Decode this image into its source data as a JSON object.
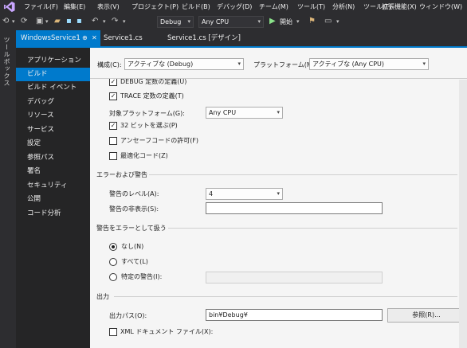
{
  "menubar": {
    "items": [
      "ファイル(F)",
      "編集(E)",
      "表示(V)",
      "プロジェクト(P)",
      "ビルド(B)",
      "デバッグ(D)",
      "チーム(M)",
      "ツール(T)",
      "分析(N)",
      "ツール(T)",
      "拡張機能(X)",
      "ウィンドウ(W)"
    ]
  },
  "toolbar": {
    "config_value": "Debug",
    "platform_value": "Any CPU",
    "start_label": "開始"
  },
  "toolbox": {
    "label": "ツールボックス"
  },
  "tabs": {
    "active": {
      "label": "WindowsService1",
      "pin": "⊕",
      "close": "✕"
    },
    "items": [
      "Service1.cs",
      "Service1.cs [デザイン]"
    ]
  },
  "nav": {
    "items": [
      "アプリケーション",
      "ビルド",
      "ビルド イベント",
      "デバッグ",
      "リソース",
      "サービス",
      "設定",
      "参照パス",
      "署名",
      "セキュリティ",
      "公開",
      "コード分析"
    ],
    "active_index": 1
  },
  "top_settings": {
    "config_label": "構成(C):",
    "config_value": "アクティブな (Debug)",
    "platform_label": "プラットフォーム(M):",
    "platform_value": "アクティブな (Any CPU)"
  },
  "general": {
    "debug_const_label": "DEBUG 定数の定義(U)",
    "trace_const_label": "TRACE 定数の定義(T)",
    "target_platform_label": "対象プラットフォーム(G):",
    "target_platform_value": "Any CPU",
    "prefer32_label": "32 ビットを選ぶ(P)",
    "unsafe_label": "アンセーフコードの許可(F)",
    "optimize_label": "最適化コード(Z)",
    "checks": {
      "debug": true,
      "trace": true,
      "prefer32": true,
      "unsafe": false,
      "optimize": false
    }
  },
  "errors": {
    "section_title": "エラーおよび警告",
    "warning_level_label": "警告のレベル(A):",
    "warning_level_value": "4",
    "suppress_label": "警告の非表示(S):",
    "suppress_value": ""
  },
  "treat_warnings": {
    "section_title": "警告をエラーとして扱う",
    "none_label": "なし(N)",
    "all_label": "すべて(L)",
    "specific_label": "特定の警告(I):",
    "specific_value": "",
    "selected": "none"
  },
  "output": {
    "section_title": "出力",
    "path_label": "出力パス(O):",
    "path_value": "bin¥Debug¥",
    "browse_label": "参照(R)...",
    "xml_doc_label": "XML ドキュメント ファイル(X):",
    "xml_doc_checked": false
  },
  "colors": {
    "accent": "#007acc",
    "chrome": "#2d2d30",
    "nav_bg": "#252526",
    "content_bg": "#f5f5f5"
  }
}
